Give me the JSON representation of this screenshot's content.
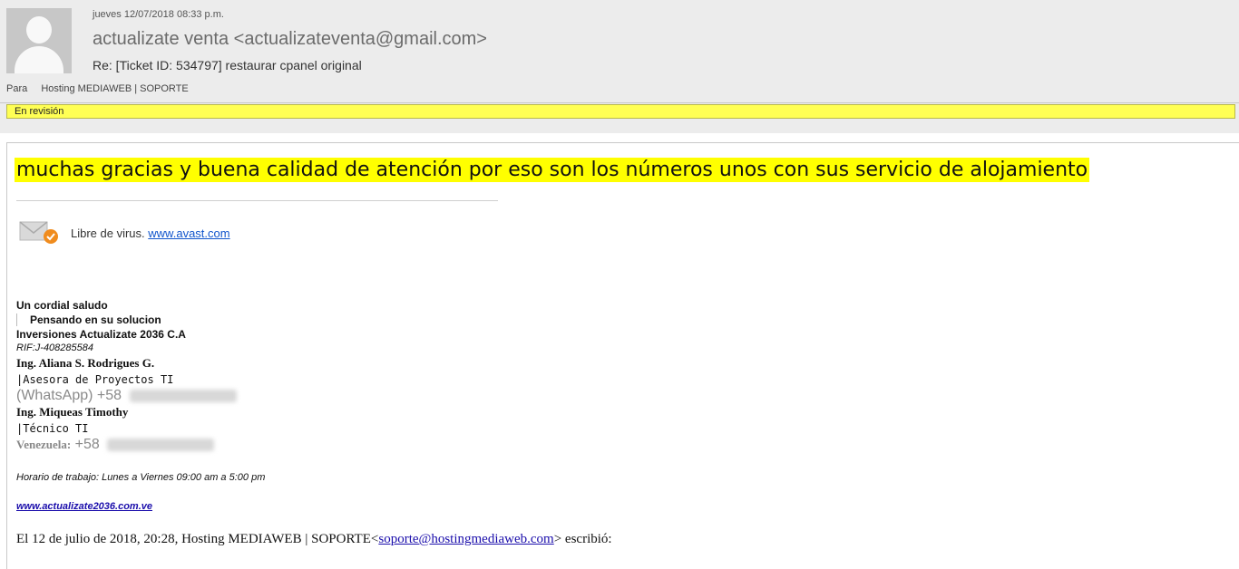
{
  "header": {
    "date": "jueves 12/07/2018 08:33 p.m.",
    "sender": "actualizate venta <actualizateventa@gmail.com>",
    "subject": "Re: [Ticket ID: 534797] restaurar cpanel original",
    "to_label": "Para",
    "to_value": "Hosting MEDIAWEB | SOPORTE",
    "status_banner": "En revisión"
  },
  "body": {
    "gratitude": "muchas gracias y buena calidad de atención por eso son los números unos con sus servicio de alojamiento",
    "virus_label": "Libre de virus.",
    "virus_link": "www.avast.com",
    "signature": {
      "greeting": "Un cordial saludo",
      "tagline": "Pensando en su solucion",
      "company": "Inversiones Actualizate 2036 C.A",
      "rif": "RIF:J-408285584",
      "person1_name": "Ing. Aliana S. Rodrigues G.",
      "person1_role": "|Asesora de Proyectos TI",
      "person1_phone_label": "(WhatsApp)",
      "person1_phone_prefix": "+58",
      "person2_name": "Ing. Miqueas Timothy",
      "person2_role": "|Técnico TI",
      "person2_phone_label": "Venezuela:",
      "person2_phone_prefix": "+58",
      "hours": "Horario de trabajo: Lunes a Viernes 09:00 am a 5:00 pm",
      "website": "www.actualizate2036.com.ve"
    },
    "quote": {
      "prefix": "El 12 de julio de 2018, 20:28, Hosting MEDIAWEB | SOPORTE<",
      "email": "soporte@hostingmediaweb.com",
      "suffix": "> escribió:"
    }
  },
  "colors": {
    "banner": "#ffff54",
    "highlight": "#ffff00",
    "link": "#1155cc",
    "header_bg": "#ececec"
  }
}
